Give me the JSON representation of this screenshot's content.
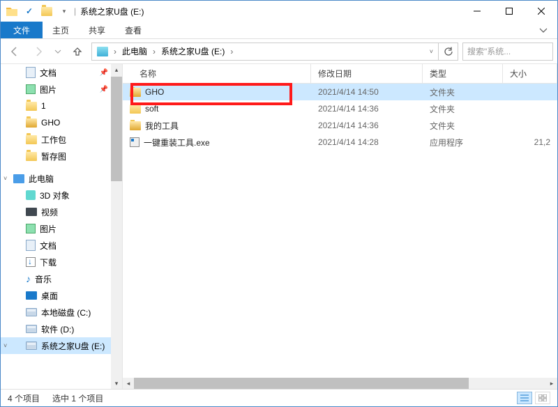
{
  "titlebar": {
    "title": "系统之家U盘 (E:)",
    "separator": "|"
  },
  "ribbon": {
    "file": "文件",
    "home": "主页",
    "share": "共享",
    "view": "查看"
  },
  "breadcrumb": {
    "seg1": "此电脑",
    "seg2": "系统之家U盘 (E:)"
  },
  "search": {
    "placeholder": "搜索\"系统..."
  },
  "tree": {
    "items": [
      {
        "label": "文档",
        "icon": "docs",
        "lvl": 2,
        "pin": true
      },
      {
        "label": "图片",
        "icon": "pics",
        "lvl": 2,
        "pin": true
      },
      {
        "label": "1",
        "icon": "folder",
        "lvl": 2
      },
      {
        "label": "GHO",
        "icon": "folder-zipped",
        "lvl": 2
      },
      {
        "label": "工作包",
        "icon": "folder",
        "lvl": 2
      },
      {
        "label": "暂存图",
        "icon": "folder",
        "lvl": 2
      },
      {
        "spacer": true
      },
      {
        "label": "此电脑",
        "icon": "pc",
        "lvl": 1,
        "expand": true
      },
      {
        "label": "3D 对象",
        "icon": "3d",
        "lvl": 2
      },
      {
        "label": "视频",
        "icon": "video",
        "lvl": 2
      },
      {
        "label": "图片",
        "icon": "pics",
        "lvl": 2
      },
      {
        "label": "文档",
        "icon": "docs",
        "lvl": 2
      },
      {
        "label": "下载",
        "icon": "dl",
        "lvl": 2
      },
      {
        "label": "音乐",
        "icon": "music",
        "lvl": 2
      },
      {
        "label": "桌面",
        "icon": "desktop",
        "lvl": 2
      },
      {
        "label": "本地磁盘 (C:)",
        "icon": "disk",
        "lvl": 2
      },
      {
        "label": "软件 (D:)",
        "icon": "disk",
        "lvl": 2
      },
      {
        "label": "系统之家U盘 (E:)",
        "icon": "disk",
        "lvl": 2,
        "selected": true,
        "expand": true
      }
    ]
  },
  "columns": {
    "name": "名称",
    "date": "修改日期",
    "type": "类型",
    "size": "大小"
  },
  "files": [
    {
      "name": "GHO",
      "date": "2021/4/14 14:50",
      "type": "文件夹",
      "size": "",
      "icon": "folder-zipped",
      "selected": true
    },
    {
      "name": "soft",
      "date": "2021/4/14 14:36",
      "type": "文件夹",
      "size": "",
      "icon": "folder"
    },
    {
      "name": "我的工具",
      "date": "2021/4/14 14:36",
      "type": "文件夹",
      "size": "",
      "icon": "folder-zipped"
    },
    {
      "name": "一键重装工具.exe",
      "date": "2021/4/14 14:28",
      "type": "应用程序",
      "size": "21,2",
      "icon": "exe"
    }
  ],
  "status": {
    "count": "4 个项目",
    "selection": "选中 1 个项目"
  }
}
